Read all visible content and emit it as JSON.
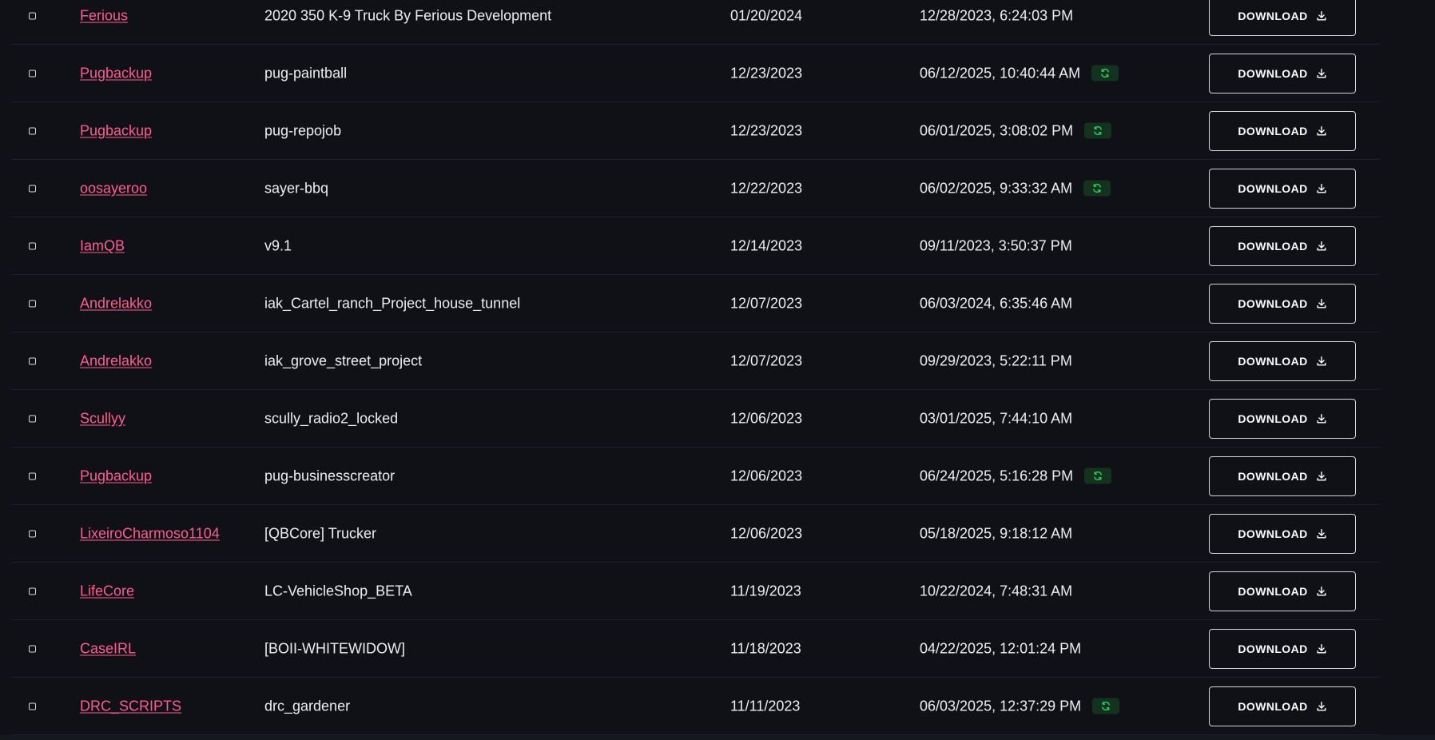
{
  "download_label": "DOWNLOAD",
  "colors": {
    "background": "#0f1117",
    "author_link": "#ff5c8f",
    "badge_bg": "#14331f",
    "badge_icon": "#2fd36b"
  },
  "rows": [
    {
      "author": "Ferious",
      "name": "2020 350 K-9 Truck By Ferious Development",
      "date": "01/20/2024",
      "updated": "12/28/2023, 6:24:03 PM",
      "synced": false
    },
    {
      "author": "Pugbackup",
      "name": "pug-paintball",
      "date": "12/23/2023",
      "updated": "06/12/2025, 10:40:44 AM",
      "synced": true
    },
    {
      "author": "Pugbackup",
      "name": "pug-repojob",
      "date": "12/23/2023",
      "updated": "06/01/2025, 3:08:02 PM",
      "synced": true
    },
    {
      "author": "oosayeroo",
      "name": "sayer-bbq",
      "date": "12/22/2023",
      "updated": "06/02/2025, 9:33:32 AM",
      "synced": true
    },
    {
      "author": "IamQB",
      "name": "v9.1",
      "date": "12/14/2023",
      "updated": "09/11/2023, 3:50:37 PM",
      "synced": false
    },
    {
      "author": "Andrelakko",
      "name": "iak_Cartel_ranch_Project_house_tunnel",
      "date": "12/07/2023",
      "updated": "06/03/2024, 6:35:46 AM",
      "synced": false
    },
    {
      "author": "Andrelakko",
      "name": "iak_grove_street_project",
      "date": "12/07/2023",
      "updated": "09/29/2023, 5:22:11 PM",
      "synced": false
    },
    {
      "author": "Scullyy",
      "name": "scully_radio2_locked",
      "date": "12/06/2023",
      "updated": "03/01/2025, 7:44:10 AM",
      "synced": false
    },
    {
      "author": "Pugbackup",
      "name": "pug-businesscreator",
      "date": "12/06/2023",
      "updated": "06/24/2025, 5:16:28 PM",
      "synced": true
    },
    {
      "author": "LixeiroCharmoso1104",
      "name": "[QBCore] Trucker",
      "date": "12/06/2023",
      "updated": "05/18/2025, 9:18:12 AM",
      "synced": false
    },
    {
      "author": "LifeCore",
      "name": "LC-VehicleShop_BETA",
      "date": "11/19/2023",
      "updated": "10/22/2024, 7:48:31 AM",
      "synced": false
    },
    {
      "author": "CaseIRL",
      "name": "[BOII-WHITEWIDOW]",
      "date": "11/18/2023",
      "updated": "04/22/2025, 12:01:24 PM",
      "synced": false
    },
    {
      "author": "DRC_SCRIPTS",
      "name": "drc_gardener",
      "date": "11/11/2023",
      "updated": "06/03/2025, 12:37:29 PM",
      "synced": true
    }
  ]
}
